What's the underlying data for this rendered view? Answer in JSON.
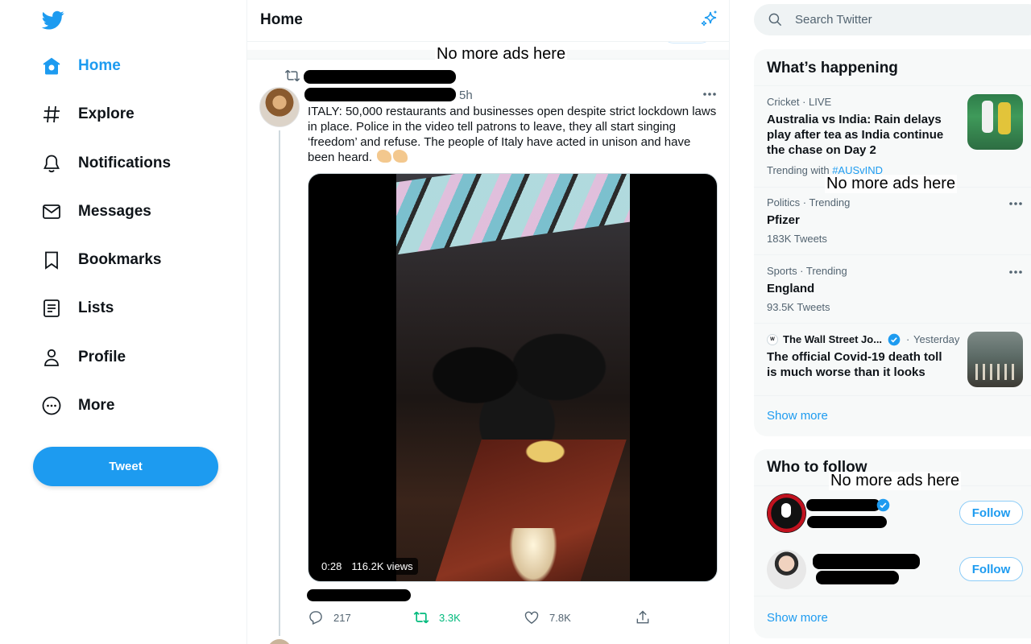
{
  "nav": {
    "logo_icon": "twitter-bird-icon",
    "items": [
      {
        "label": "Home",
        "icon": "home-icon",
        "active": true
      },
      {
        "label": "Explore",
        "icon": "hashtag-icon"
      },
      {
        "label": "Notifications",
        "icon": "bell-icon"
      },
      {
        "label": "Messages",
        "icon": "envelope-icon"
      },
      {
        "label": "Bookmarks",
        "icon": "bookmark-icon"
      },
      {
        "label": "Lists",
        "icon": "list-icon"
      },
      {
        "label": "Profile",
        "icon": "person-icon"
      },
      {
        "label": "More",
        "icon": "more-circle-icon"
      }
    ],
    "tweet_button": "Tweet"
  },
  "main": {
    "title": "Home",
    "annotation": "No more ads here",
    "tweet": {
      "time": "5h",
      "text": "ITALY: 50,000 restaurants and businesses open despite strict lockdown laws in place. Police in the video tell patrons to leave, they all start singing ‘freedom’ and refuse. The people of Italy have acted in unison and have been heard.",
      "media": {
        "duration": "0:28",
        "views": "116.2K views"
      },
      "actions": {
        "replies": "217",
        "retweets": "3.3K",
        "likes": "7.8K"
      }
    }
  },
  "sidebar": {
    "search_placeholder": "Search Twitter",
    "happening": {
      "title": "What’s happening",
      "annotation": "No more ads here",
      "trends": [
        {
          "category": "Cricket",
          "live": "LIVE",
          "headline": "Australia vs India: Rain delays play after tea as India continue the chase on Day 2",
          "trending_with_label": "Trending with",
          "trending_with_tag": "#AUSvIND"
        },
        {
          "meta": "Politics · Trending",
          "name": "Pfizer",
          "count": "183K Tweets"
        },
        {
          "meta": "Sports · Trending",
          "name": "England",
          "count": "93.5K Tweets"
        },
        {
          "source": "The Wall Street Jo...",
          "time": "Yesterday",
          "headline": "The official Covid-19 death toll is much worse than it looks"
        }
      ],
      "show_more": "Show more"
    },
    "who_to_follow": {
      "title": "Who to follow",
      "annotation": "No more ads here",
      "follow_label": "Follow",
      "show_more": "Show more"
    }
  },
  "colors": {
    "accent": "#1d9bf0",
    "retweet_green": "#00ba7c",
    "text_primary": "#0f1419",
    "text_secondary": "#536471"
  }
}
